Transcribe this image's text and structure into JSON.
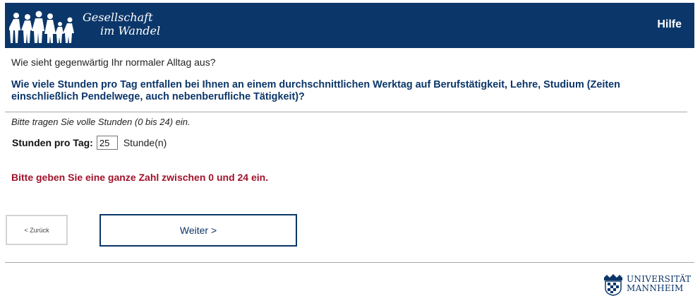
{
  "header": {
    "logo_line1": "Gesellschaft",
    "logo_line2": "im Wandel",
    "help_label": "Hilfe"
  },
  "survey": {
    "intro": "Wie sieht gegenwärtig Ihr normaler Alltag aus?",
    "question": "Wie viele Stunden pro Tag entfallen bei Ihnen an einem durchschnittlichen Werktag auf Berufstätigkeit, Lehre, Studium (Zeiten einschließlich Pendelwege, auch nebenberufliche Tätigkeit)?",
    "instruction": "Bitte tragen Sie volle Stunden (0 bis 24) ein.",
    "field_label": "Stunden pro Tag:",
    "field_value": "25",
    "unit_label": "Stunde(n)",
    "error": "Bitte geben Sie eine ganze Zahl zwischen 0 und 24 ein."
  },
  "nav": {
    "back_label": "< Zurück",
    "next_label": "Weiter >"
  },
  "footer": {
    "uni_line1": "UNIVERSITÄT",
    "uni_line2": "MANNHEIM"
  },
  "colors": {
    "brand": "#0b3669",
    "error": "#a1122a"
  }
}
